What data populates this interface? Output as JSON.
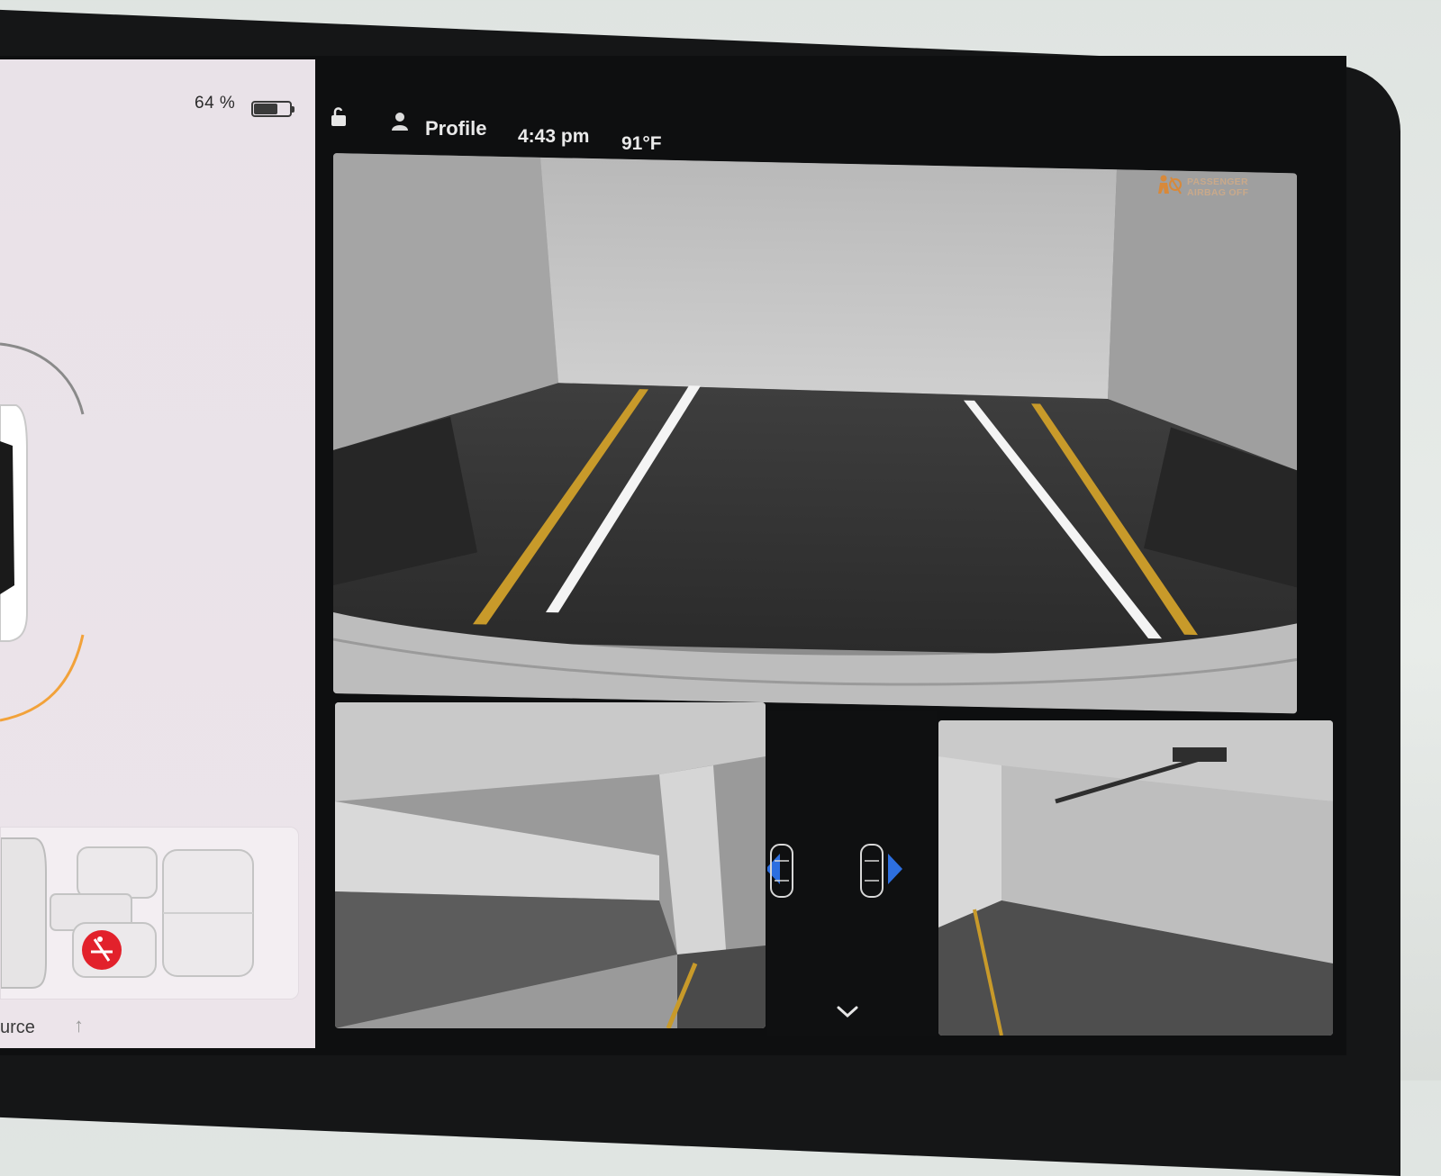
{
  "status": {
    "battery_percent_label": "64 %",
    "battery_level": 0.64
  },
  "topbar": {
    "profile_label": "Profile",
    "time": "4:43 pm",
    "temperature": "91°F"
  },
  "alerts": {
    "airbag_line1": "PASSENGER",
    "airbag_line2": "AIRBAG OFF"
  },
  "left_panel": {
    "source_label": "urce"
  },
  "colors": {
    "path_line": "#f2a23a",
    "airbag_text": "#c9a98a",
    "belt_warning": "#e2212b",
    "mirror_indicator": "#2d6fe0"
  },
  "icons": {
    "lock": "unlocked-padlock-icon",
    "profile": "person-icon",
    "airbag": "airbag-off-icon",
    "seatbelt": "seatbelt-warning-icon",
    "chevron": "chevron-down-icon"
  }
}
